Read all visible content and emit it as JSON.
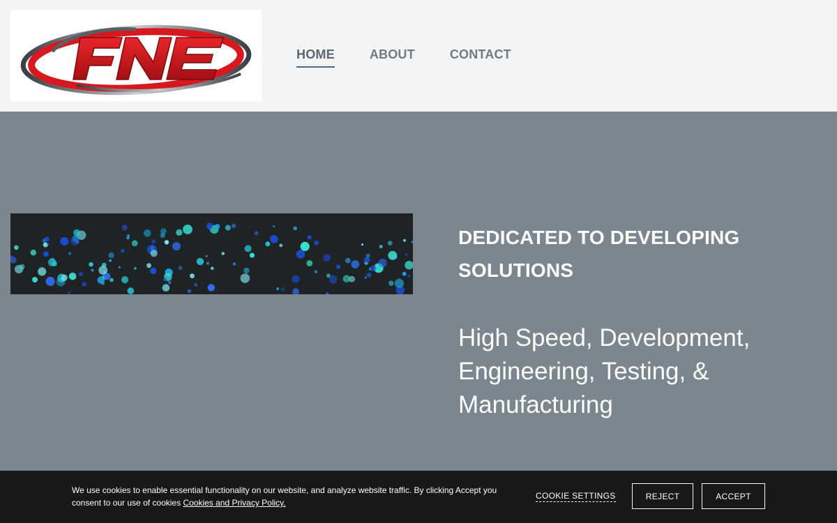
{
  "logo": {
    "text": "FNE",
    "icon": "fne-logo"
  },
  "nav": {
    "items": [
      {
        "label": "HOME",
        "active": true
      },
      {
        "label": "ABOUT",
        "active": false
      },
      {
        "label": "CONTACT",
        "active": false
      }
    ]
  },
  "hero": {
    "image": "fiber-optic-lights-image",
    "heading": "DEDICATED TO DEVELOPING SOLUTIONS",
    "subheading": "High Speed, Development, Engineering, Testing, & Manufacturing"
  },
  "cookie": {
    "text": "We use cookies to enable essential functionality on our website, and analyze website traffic. By clicking Accept you consent to our use of cookies",
    "link_label": "Cookies and Privacy Policy.",
    "settings_label": "COOKIE SETTINGS",
    "reject_label": "REJECT",
    "accept_label": "ACCEPT"
  },
  "colors": {
    "header_bg": "#f3f4f6",
    "hero_bg": "#7b868e",
    "cookie_bg": "#161819",
    "logo_red": "#d7191f",
    "logo_gray": "#5a5f66"
  }
}
